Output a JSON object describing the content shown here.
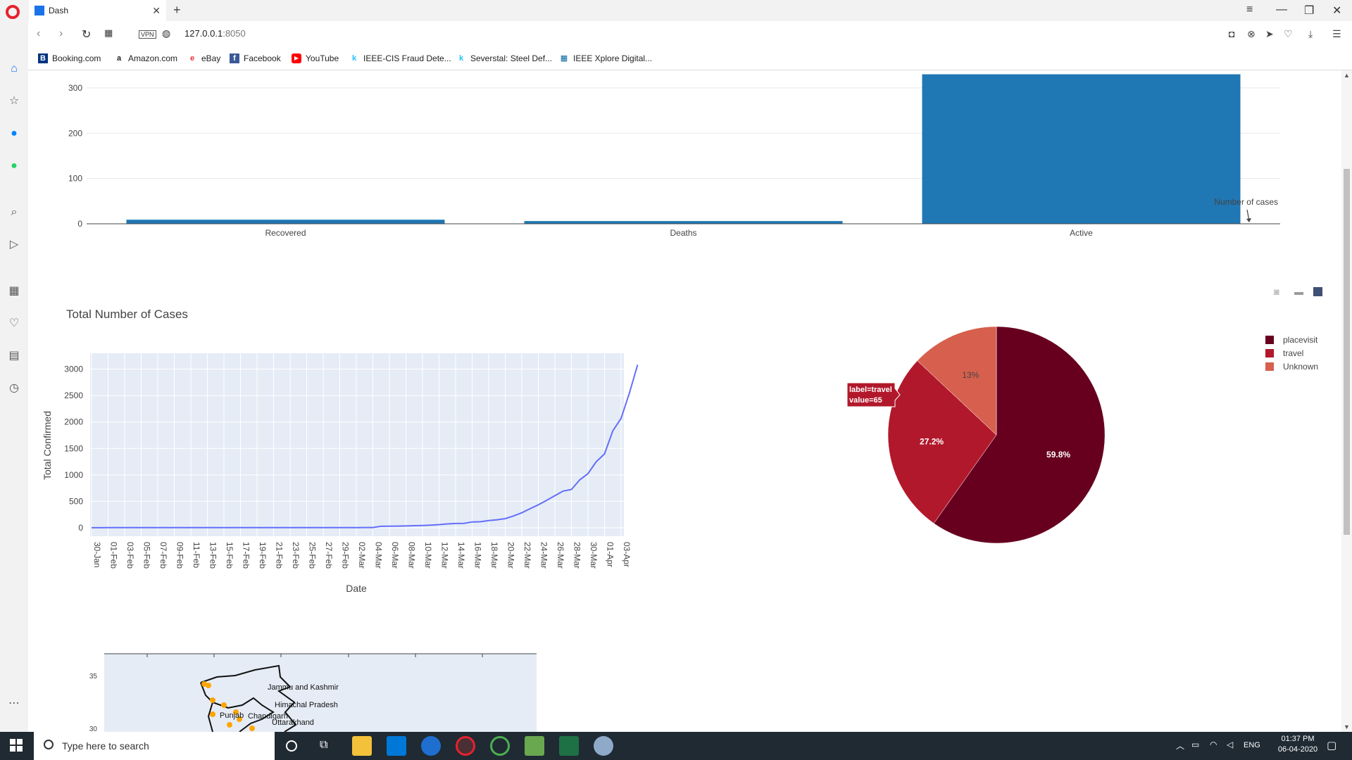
{
  "browser": {
    "tab_title": "Dash",
    "url_host": "127.0.0.1",
    "url_port": ":8050",
    "vpn_label": "VPN"
  },
  "bookmarks": [
    {
      "label": "Booking.com",
      "icon": "B",
      "color": "#003580"
    },
    {
      "label": "Amazon.com",
      "icon": "a",
      "color": "#222222"
    },
    {
      "label": "eBay",
      "icon": "e",
      "color": "#e53238"
    },
    {
      "label": "Facebook",
      "icon": "f",
      "color": "#3b5998"
    },
    {
      "label": "YouTube",
      "icon": "▶",
      "color": "#ff0000"
    },
    {
      "label": "IEEE-CIS Fraud Dete...",
      "icon": "k",
      "color": "#20beff"
    },
    {
      "label": "Severstal: Steel Def...",
      "icon": "k",
      "color": "#20beff"
    },
    {
      "label": "IEEE Xplore Digital...",
      "icon": "▦",
      "color": "#00629b"
    }
  ],
  "bar_chart": {
    "chart_data": {
      "type": "bar",
      "categories": [
        "Recovered",
        "Deaths",
        "Active"
      ],
      "values": [
        9,
        6,
        330
      ],
      "ylim": [
        0,
        320
      ],
      "yticks": [
        0,
        100,
        200,
        300
      ],
      "annotation": "Number of cases"
    }
  },
  "line_chart": {
    "chart_data": {
      "type": "line",
      "title": "Total Number of Cases",
      "xlabel": "Date",
      "ylabel": "Total Confirmed",
      "x_ticks": [
        "30-Jan",
        "01-Feb",
        "03-Feb",
        "05-Feb",
        "07-Feb",
        "09-Feb",
        "11-Feb",
        "13-Feb",
        "15-Feb",
        "17-Feb",
        "19-Feb",
        "21-Feb",
        "23-Feb",
        "25-Feb",
        "27-Feb",
        "29-Feb",
        "02-Mar",
        "04-Mar",
        "06-Mar",
        "08-Mar",
        "10-Mar",
        "12-Mar",
        "14-Mar",
        "16-Mar",
        "18-Mar",
        "20-Mar",
        "22-Mar",
        "24-Mar",
        "26-Mar",
        "28-Mar",
        "30-Mar",
        "01-Apr",
        "03-Apr"
      ],
      "yticks": [
        0,
        500,
        1000,
        1500,
        2000,
        2500,
        3000
      ],
      "ylim": [
        -160,
        3300
      ],
      "values": [
        1,
        1,
        2,
        3,
        3,
        3,
        3,
        3,
        3,
        3,
        3,
        3,
        3,
        3,
        3,
        3,
        3,
        3,
        3,
        3,
        3,
        3,
        3,
        3,
        3,
        3,
        3,
        3,
        3,
        3,
        3,
        3,
        3,
        5,
        5,
        28,
        30,
        31,
        34,
        39,
        43,
        50,
        60,
        73,
        81,
        84,
        110,
        114,
        137,
        151,
        173,
        223,
        283,
        360,
        434,
        519,
        606,
        694,
        724,
        906,
        1024,
        1251,
        1397,
        1834,
        2069,
        2547,
        3082
      ],
      "line_color": "#636efa"
    }
  },
  "pie_chart": {
    "chart_data": {
      "type": "pie",
      "labels": [
        "placevisit",
        "travel",
        "Unknown"
      ],
      "values": [
        59.8,
        27.2,
        13
      ],
      "display": [
        "59.8%",
        "27.2%",
        "13%"
      ],
      "colors": [
        "#67001f",
        "#b2182b",
        "#d6604d"
      ],
      "legend_position": "top-right",
      "hover": {
        "line1": "label=travel",
        "line2": "value=65"
      }
    }
  },
  "map": {
    "yticks": [
      "35",
      "30"
    ],
    "labels": [
      "Jammu and Kashmir",
      "Himachal Pradesh",
      "Punjab",
      "Chandigarh",
      "Uttarakhand"
    ]
  },
  "taskbar": {
    "search_placeholder": "Type here to search",
    "lang": "ENG",
    "time": "01:37 PM",
    "date": "06-04-2020"
  }
}
